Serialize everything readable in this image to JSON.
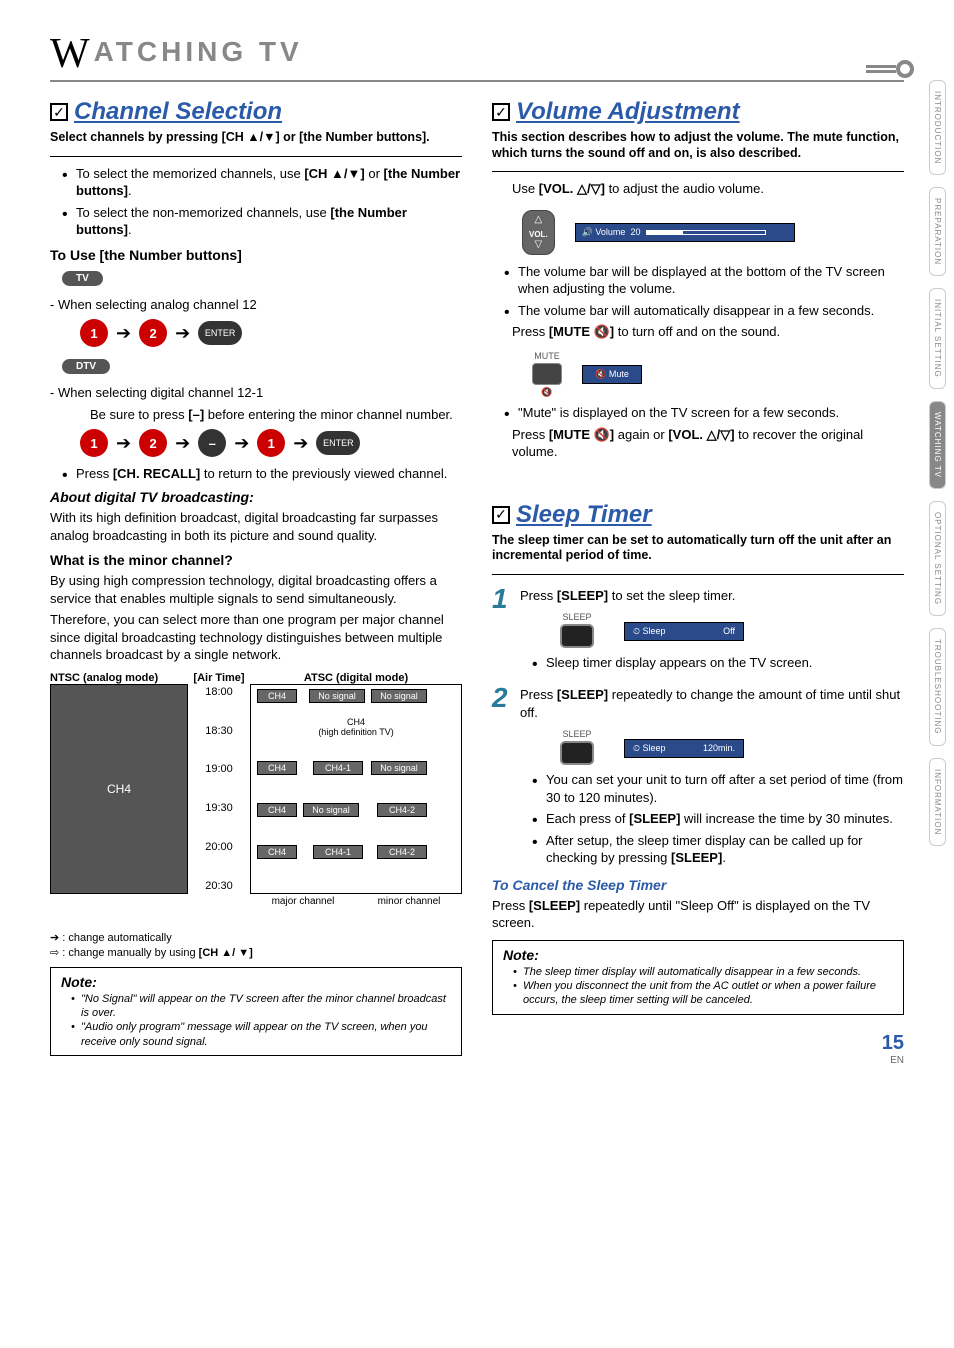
{
  "chapter": {
    "big": "W",
    "rest": "ATCHING TV"
  },
  "tabs": [
    "INTRODUCTION",
    "PREPARATION",
    "INITIAL SETTING",
    "WATCHING TV",
    "OPTIONAL SETTING",
    "TROUBLESHOOTING",
    "INFORMATION"
  ],
  "left": {
    "sec_title": "Channel Selection",
    "sec_sub": "Select channels by pressing [CH ▲/▼] or [the Number buttons].",
    "b1a": "To select the memorized channels, use ",
    "b1b": "[CH ▲/▼]",
    "b1c": " or ",
    "b1d": "[the Number buttons]",
    "b1e": ".",
    "b2a": "To select the non-memorized channels, use ",
    "b2b": "[the Number buttons]",
    "b2c": ".",
    "h_use": "To Use [the Number buttons]",
    "pill_tv": "TV",
    "analog_line": "- When selecting analog channel 12",
    "k1": "1",
    "k2": "2",
    "kenter": "ENTER",
    "pill_dtv": "DTV",
    "digital_line1": "- When selecting digital channel 12-1",
    "digital_line2": "Be sure to press ",
    "digital_line2b": "[–]",
    "digital_line2c": " before entering the minor channel number.",
    "kdash": "–",
    "recall_a": "Press ",
    "recall_b": "[CH. RECALL]",
    "recall_c": " to return to the previously viewed channel.",
    "about_h": "About digital TV broadcasting:",
    "about_p": "With its high definition broadcast, digital broadcasting far surpasses analog broadcasting in both its picture and sound quality.",
    "minor_h": "What is the minor channel?",
    "minor_p1": "By using high compression technology, digital broadcasting offers a service that enables multiple signals to send simultaneously.",
    "minor_p2": "Therefore, you can select more than one program per major channel since digital broadcasting technology distinguishes between multiple channels broadcast by a single network.",
    "chart": {
      "ntsc_h": "NTSC (analog mode)",
      "air_h": "[Air Time]",
      "atsc_h": "ATSC (digital mode)",
      "ntsc_cell": "CH4",
      "times": [
        "18:00",
        "18:30",
        "19:00",
        "19:30",
        "20:00",
        "20:30"
      ],
      "cells": {
        "c1": "CH4",
        "ns": "No signal",
        "hd": "CH4\n(high definition TV)",
        "c41": "CH4-1",
        "c42": "CH4-2"
      },
      "major": "major channel",
      "minor": "minor channel"
    },
    "legend1": ": change automatically",
    "legend2": ": change manually by using ",
    "legend2b": "[CH ▲/ ▼]",
    "note_h": "Note:",
    "note1": "\"No Signal\" will appear on the TV screen after the minor channel broadcast is over.",
    "note2": "\"Audio only program\" message will appear on the TV screen, when you receive only sound signal."
  },
  "right": {
    "vol_title": "Volume Adjustment",
    "vol_sub": "This section describes how to adjust the volume. The mute function, which turns the sound off and on, is also described.",
    "vol_use_a": "Use ",
    "vol_use_b": "[VOL. △/▽]",
    "vol_use_c": " to adjust the audio volume.",
    "vol_btn": "VOL.",
    "osd_vol_label": "Volume",
    "osd_vol_val": "20",
    "vb1": "The volume bar will be displayed at the bottom of the TV screen when adjusting the volume.",
    "vb2": "The volume bar will automatically disappear in a few seconds.",
    "mute_a": "Press ",
    "mute_b": "[MUTE 🔇]",
    "mute_c": " to turn off and on the sound.",
    "mute_lbl": "MUTE",
    "osd_mute": "Mute",
    "mb1": "\"Mute\" is displayed on the TV screen for a few seconds.",
    "mute2_a": "Press ",
    "mute2_b": "[MUTE 🔇]",
    "mute2_c": " again or ",
    "mute2_d": "[VOL. △/▽]",
    "mute2_e": " to recover the original volume.",
    "sleep_title": "Sleep Timer",
    "sleep_sub": "The sleep timer can be set to automatically turn off the unit after an incremental period of time.",
    "s1a": "Press ",
    "s1b": "[SLEEP]",
    "s1c": " to set the sleep timer.",
    "sleep_btn": "SLEEP",
    "osd_sleep1_l": "Sleep",
    "osd_sleep1_v": "Off",
    "s1n": "Sleep timer display appears on the TV screen.",
    "s2a": "Press ",
    "s2b": "[SLEEP]",
    "s2c": " repeatedly to change the amount of time until shut off.",
    "osd_sleep2_l": "Sleep",
    "osd_sleep2_v": "120min.",
    "s2n1": "You can set your unit to turn off after a set period of time (from 30 to 120 minutes).",
    "s2n2a": "Each press of ",
    "s2n2b": "[SLEEP]",
    "s2n2c": " will increase the time by 30 minutes.",
    "s2n3a": "After setup, the sleep timer display can be called up for checking by pressing ",
    "s2n3b": "[SLEEP]",
    "s2n3c": ".",
    "cancel_h": "To Cancel the Sleep Timer",
    "cancel_a": "Press ",
    "cancel_b": "[SLEEP]",
    "cancel_c": " repeatedly until \"Sleep Off\" is displayed on the TV screen.",
    "note_h": "Note:",
    "rn1": "The sleep timer display will automatically disappear in a few seconds.",
    "rn2": "When you disconnect the unit from the AC outlet or when a power failure occurs, the sleep timer setting will be canceled."
  },
  "footer": {
    "page": "15",
    "en": "EN"
  }
}
